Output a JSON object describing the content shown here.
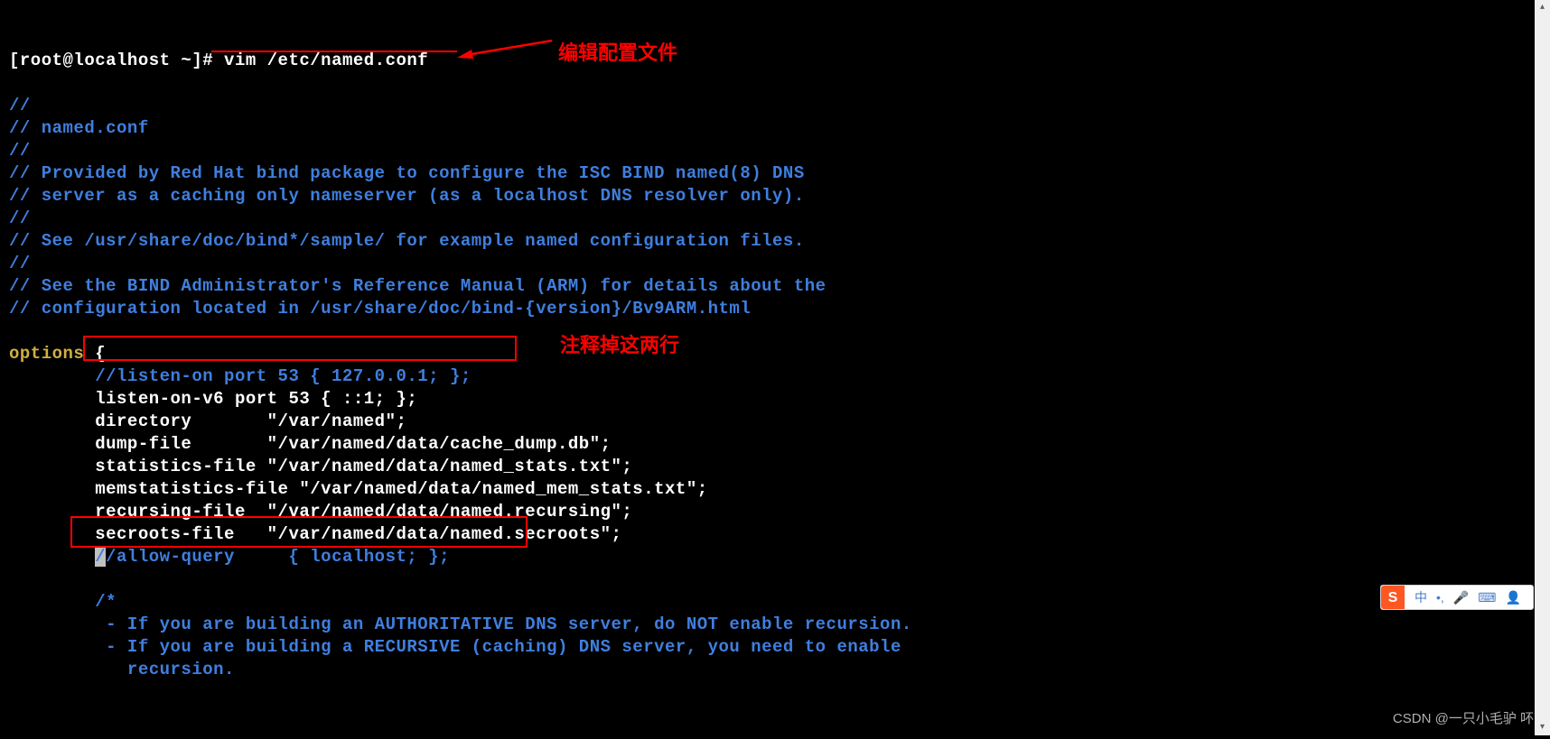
{
  "prompt": "[root@localhost ~]# ",
  "command": "vim /etc/named.conf",
  "annotations": {
    "edit_config": "编辑配置文件",
    "comment_lines": "注释掉这两行"
  },
  "file_comments": [
    "//",
    "// named.conf",
    "//",
    "// Provided by Red Hat bind package to configure the ISC BIND named(8) DNS",
    "// server as a caching only nameserver (as a localhost DNS resolver only).",
    "//",
    "// See /usr/share/doc/bind*/sample/ for example named configuration files.",
    "//",
    "// See the BIND Administrator's Reference Manual (ARM) for details about the",
    "// configuration located in /usr/share/doc/bind-{version}/Bv9ARM.html"
  ],
  "options_keyword": "options",
  "options_brace": " {",
  "config_lines": {
    "listen_on": "        //listen-on port 53 { 127.0.0.1; };",
    "listen_on_v6": "        listen-on-v6 port 53 { ::1; };",
    "directory": "        directory       \"/var/named\";",
    "dump_file": "        dump-file       \"/var/named/data/cache_dump.db\";",
    "statistics": "        statistics-file \"/var/named/data/named_stats.txt\";",
    "memstats": "        memstatistics-file \"/var/named/data/named_mem_stats.txt\";",
    "recursing": "        recursing-file  \"/var/named/data/named.recursing\";",
    "secroots": "        secroots-file   \"/var/named/data/named.secroots\";",
    "allow_query_pre": "        ",
    "allow_query_caret": "/",
    "allow_query_post": "/allow-query     { localhost; };"
  },
  "block_comment": [
    "        /*",
    "         - If you are building an AUTHORITATIVE DNS server, do NOT enable recursion.",
    "         - If you are building a RECURSIVE (caching) DNS server, you need to enable",
    "           recursion."
  ],
  "watermark": "CSDN @一只小毛驴 吥",
  "ime": {
    "logo": "S",
    "lang": "中",
    "items": [
      "•,",
      "🎤",
      "⌨",
      "👤"
    ]
  },
  "scroll": {
    "up": "▴",
    "down": "▾"
  }
}
